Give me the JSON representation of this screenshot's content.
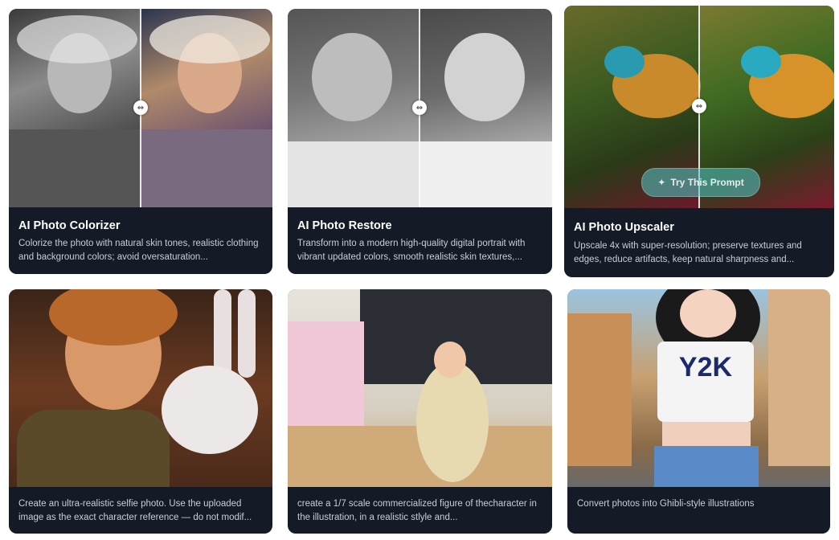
{
  "cards": [
    {
      "title": "AI Photo Colorizer",
      "desc": "Colorize the photo with natural skin tones, realistic clothing and background colors; avoid oversaturation..."
    },
    {
      "title": "AI Photo Restore",
      "desc": "Transform into a modern high-quality digital portrait with vibrant updated colors, smooth realistic skin textures,..."
    },
    {
      "title": "AI Photo Upscaler",
      "desc": "Upscale 4x with super-resolution; preserve textures and edges, reduce artifacts, keep natural sharpness and...",
      "button_label": "Try This Prompt"
    },
    {
      "desc": "Create an ultra-realistic selfie photo. Use the uploaded image as the exact character reference — do not modif..."
    },
    {
      "desc": "create a 1/7 scale commercialized figure of thecharacter in the illustration, in a realistic stlyle and..."
    },
    {
      "desc": "Convert photos into Ghibli-style illustrations",
      "image_text": "Y2K"
    }
  ],
  "icons": {
    "compare_handle": "compare-handle-icon",
    "sparkle": "sparkle-icon"
  }
}
